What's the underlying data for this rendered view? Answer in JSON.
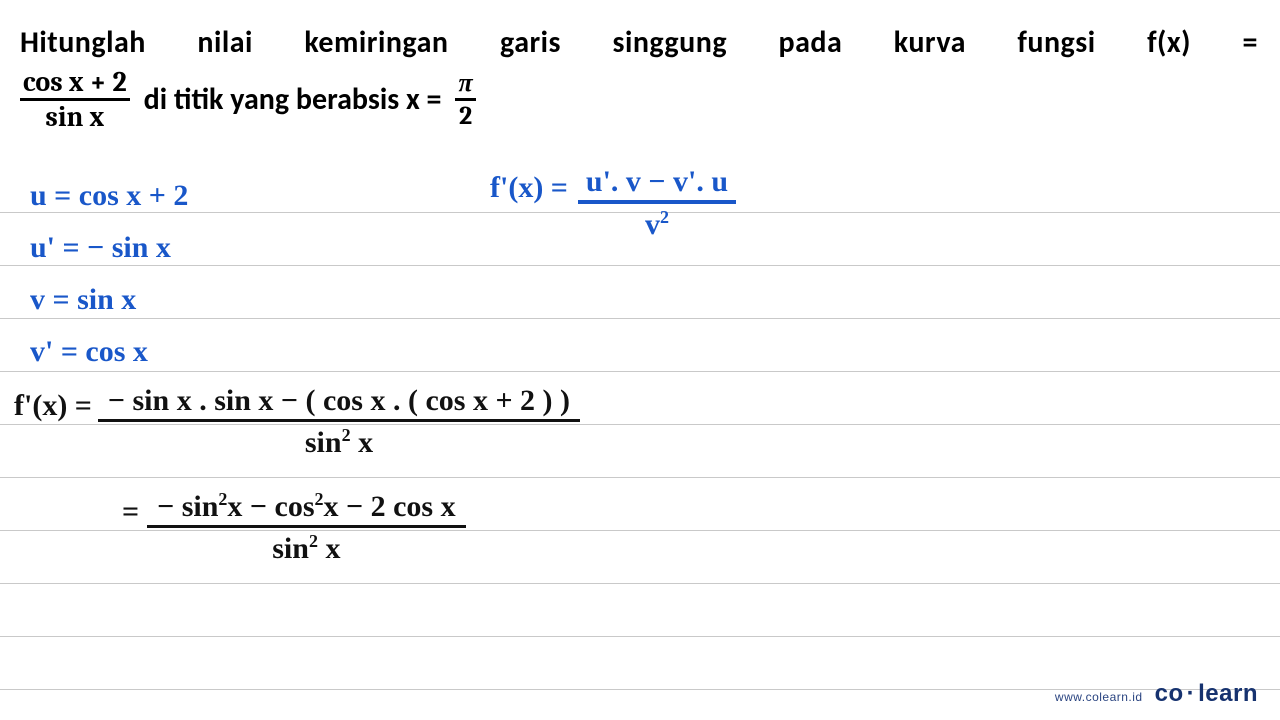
{
  "problem": {
    "line1_words": [
      "Hitunglah",
      "nilai",
      "kemiringan",
      "garis",
      "singgung",
      "pada",
      "kurva",
      "fungsi",
      "f(x)",
      "="
    ],
    "frac1_num": "cos x + 2",
    "frac1_den": "sin x",
    "line2_mid": "di titik yang berabsis x =",
    "frac2_num": "π",
    "frac2_den": "2"
  },
  "work_blue": {
    "u_def": "u = cos x + 2",
    "u_prime": "u' = − sin x",
    "v_def": "v = sin x",
    "v_prime": "v' = cos x",
    "rule_lhs": "f'(x) =",
    "rule_num": "u'. v − v'. u",
    "rule_den_base": "v",
    "rule_den_exp": "2"
  },
  "work_black": {
    "l1_lhs": "f'(x) =",
    "l1_num": "− sin x . sin x − ( cos x . ( cos x + 2 ) )",
    "l1_den_a": "sin",
    "l1_den_exp": "2",
    "l1_den_b": " x",
    "l2_eq": "=",
    "l2_num_a": "− sin",
    "l2_num_b": "x − cos",
    "l2_num_c": "x − 2 cos x",
    "l2_exp": "2",
    "l2_den_a": "sin",
    "l2_den_exp": "2",
    "l2_den_b": " x"
  },
  "watermark": {
    "url": "www.colearn.id",
    "brand_a": "co",
    "brand_dot": "·",
    "brand_b": "learn"
  }
}
